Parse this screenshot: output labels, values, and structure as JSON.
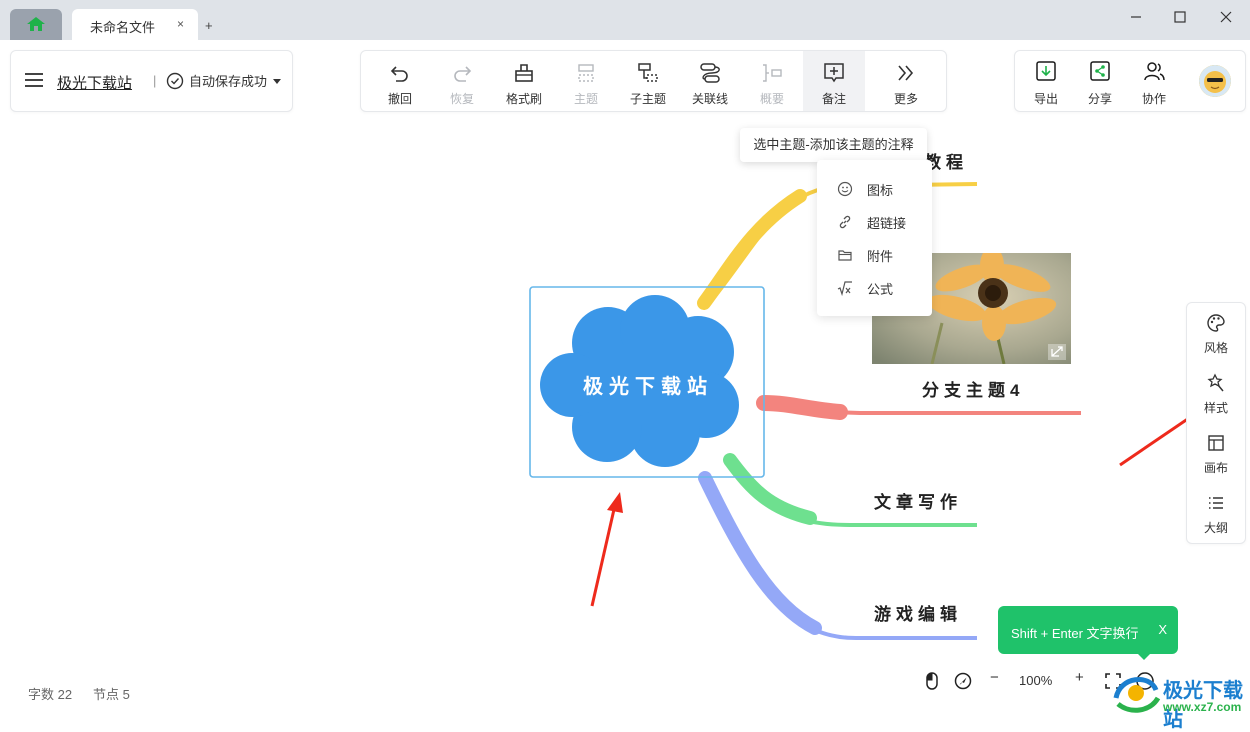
{
  "tabs": {
    "home_icon": "home-icon",
    "file_tab_title": "未命名文件",
    "close_label": "×",
    "new_tab_label": "+"
  },
  "window": {
    "minimize": "—",
    "maximize": "☐",
    "close": "✕"
  },
  "header": {
    "doc_title": "极光下载站",
    "separator": "|",
    "autosave": "自动保存成功"
  },
  "toolbar": {
    "undo": "撤回",
    "redo": "恢复",
    "format_brush": "格式刷",
    "topic": "主题",
    "subtopic": "子主题",
    "relation": "关联线",
    "summary": "概要",
    "note": "备注",
    "more": "更多"
  },
  "right_toolbar": {
    "export": "导出",
    "share": "分享",
    "collab": "协作"
  },
  "tooltip": "选中主题-添加该主题的注释",
  "dropdown": {
    "items": [
      "图标",
      "超链接",
      "附件",
      "公式"
    ]
  },
  "mindmap": {
    "central": "极光下载站",
    "branches": {
      "top": "教程",
      "image_branch": "分支主题4",
      "writing": "文章写作",
      "game": "游戏编辑"
    },
    "colors": {
      "central_fill": "#3b97e8",
      "branch_yellow": "#f7cf45",
      "branch_red": "#f3847e",
      "branch_green": "#6ee08f",
      "branch_blue": "#94a8f7",
      "selection": "#66b7ea"
    }
  },
  "side_panel": {
    "style": "风格",
    "format": "样式",
    "canvas": "画布",
    "outline": "大纲"
  },
  "status": {
    "word_count": "字数 22",
    "node_count": "节点 5"
  },
  "zoom": {
    "minus": "−",
    "level": "100%",
    "plus": "+"
  },
  "toast": {
    "text": "Shift + Enter 文字换行",
    "close": "X"
  },
  "watermark": {
    "name": "极光下载站",
    "url": "www.xz7.com"
  }
}
